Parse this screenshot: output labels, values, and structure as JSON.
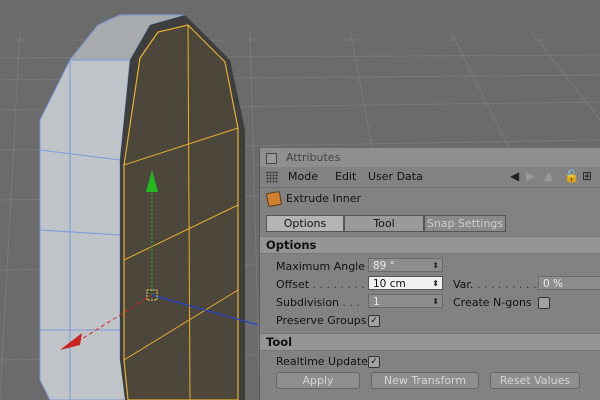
{
  "window": {
    "title": "Attributes"
  },
  "menubar": {
    "items": [
      "Mode",
      "Edit",
      "User Data"
    ]
  },
  "tool": {
    "name": "Extrude Inner"
  },
  "tabs": [
    "Options",
    "Tool",
    "Snap Settings"
  ],
  "sections": {
    "options": "Options",
    "tool": "Tool"
  },
  "options": {
    "max_angle_label": "Maximum Angle",
    "max_angle_value": "89 °",
    "offset_label": "Offset",
    "offset_value": "10 cm",
    "var_label": "Var.",
    "var_value": "0 %",
    "subdivision_label": "Subdivision",
    "subdivision_value": "1",
    "create_ngons_label": "Create N-gons",
    "preserve_groups_label": "Preserve Groups",
    "preserve_groups_checked": "✓"
  },
  "tool_section": {
    "realtime_update_label": "Realtime Update",
    "realtime_update_checked": "✓"
  },
  "buttons": {
    "apply": "Apply",
    "new_transform": "New Transform",
    "reset_values": "Reset Values"
  },
  "icons": [
    "back-arrow-icon",
    "up-arrow-icon",
    "lock-icon",
    "new-panel-icon",
    "extrude-inner-icon"
  ],
  "colors": {
    "selection_edge": "#e8b030",
    "axis_y": "#22aa22",
    "axis_x": "#cc2222",
    "axis_z": "#2244cc"
  }
}
